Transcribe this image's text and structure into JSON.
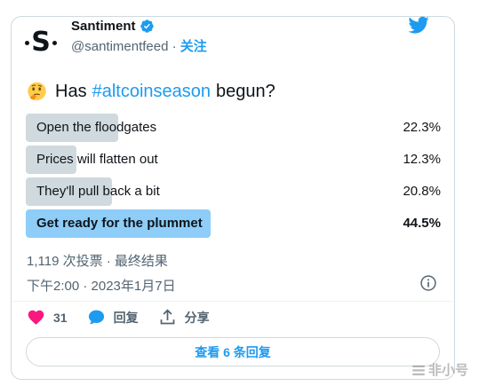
{
  "tweet": {
    "author_name": "Santiment",
    "handle": "@santimentfeed",
    "separator": " · ",
    "follow_label": "关注",
    "text_before": "Has",
    "hashtag": "#altcoinseason",
    "text_after": "begun?",
    "emoji": "thinking-face",
    "poll": {
      "options": [
        {
          "label": "Open the floodgates",
          "percent": "22.3%",
          "fill": 22.3
        },
        {
          "label": "Prices will flatten out",
          "percent": "12.3%",
          "fill": 12.3
        },
        {
          "label": "They'll pull back a bit",
          "percent": "20.8%",
          "fill": 20.8
        },
        {
          "label": "Get ready for the plummet",
          "percent": "44.5%",
          "fill": 44.5
        }
      ],
      "meta": "1,119 次投票 · 最终结果"
    },
    "timestamp": "下午2:00 · 2023年1月7日",
    "actions": {
      "like_count": "31",
      "reply_label": "回复",
      "share_label": "分享"
    },
    "replies_button": "查看 6 条回复"
  },
  "watermark": "非小号",
  "colors": {
    "accent": "#1d9bf0",
    "poll_bar": "#cfd9de",
    "poll_winner": "#8ecdf8",
    "like": "#f91880"
  }
}
